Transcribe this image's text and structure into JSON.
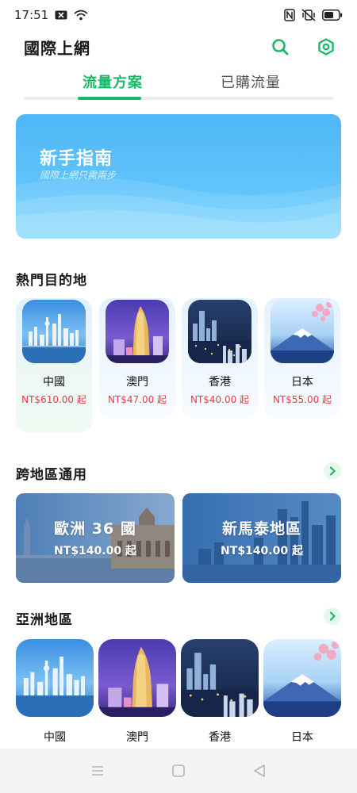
{
  "status_bar": {
    "time": "17:51"
  },
  "header": {
    "title": "國際上網"
  },
  "tabs": [
    {
      "label": "流量方案"
    },
    {
      "label": "已購流量"
    }
  ],
  "guide": {
    "title": "新手指南",
    "subtitle": "國際上網只需兩步"
  },
  "hot": {
    "title": "熱門目的地",
    "items": [
      {
        "name": "中國",
        "price": "NT$610.00 起",
        "image": "skyline-photo"
      },
      {
        "name": "澳門",
        "price": "NT$47.00 起",
        "image": "casino-photo"
      },
      {
        "name": "香港",
        "price": "NT$40.00 起",
        "image": "harbour-night-photo"
      },
      {
        "name": "日本",
        "price": "NT$55.00 起",
        "image": "mount-fuji-photo"
      }
    ]
  },
  "cross_region": {
    "title": "跨地區通用",
    "items": [
      {
        "title": "歐洲 36 國",
        "price": "NT$140.00 起"
      },
      {
        "title": "新馬泰地區",
        "price": "NT$140.00 起"
      }
    ]
  },
  "asia": {
    "title": "亞洲地區",
    "items": [
      {
        "name": "中國"
      },
      {
        "name": "澳門"
      },
      {
        "name": "香港"
      },
      {
        "name": "日本"
      }
    ]
  },
  "colors": {
    "accent": "#1bb86a",
    "price": "#e33c4a",
    "banner": "#5fc3fb"
  }
}
